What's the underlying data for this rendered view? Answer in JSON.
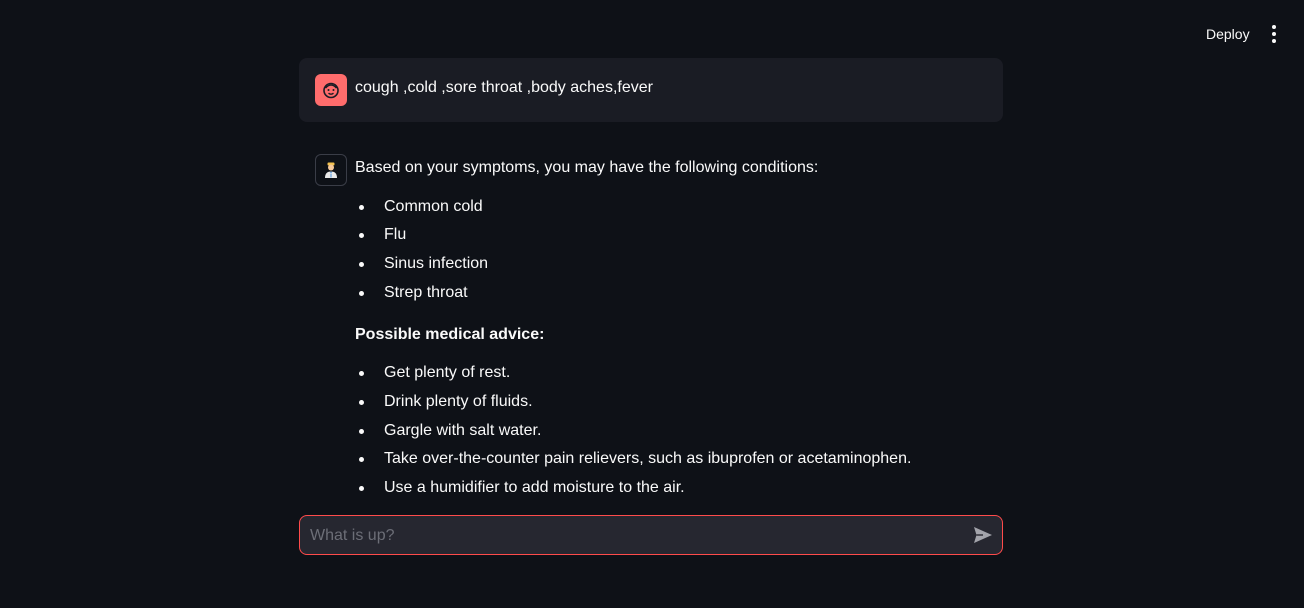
{
  "header": {
    "deploy_label": "Deploy",
    "menu_icon": "vertical-ellipsis-icon"
  },
  "messages": {
    "user": {
      "avatar_icon": "face-icon",
      "avatar_color": "#ff6c6c",
      "text": "cough ,cold ,sore throat ,body aches,fever"
    },
    "assistant": {
      "avatar_icon": "doctor-icon",
      "intro": "Based on your symptoms, you may have the following conditions:",
      "conditions": [
        "Common cold",
        "Flu",
        "Sinus infection",
        "Strep throat"
      ],
      "advice_heading": "Possible medical advice:",
      "advice": [
        "Get plenty of rest.",
        "Drink plenty of fluids.",
        "Gargle with salt water.",
        "Take over-the-counter pain relievers, such as ibuprofen or acetaminophen.",
        "Use a humidifier to add moisture to the air."
      ]
    }
  },
  "chat_input": {
    "placeholder": "What is up?",
    "value": "",
    "send_icon": "send-icon",
    "border_color": "#ff4b4b"
  }
}
